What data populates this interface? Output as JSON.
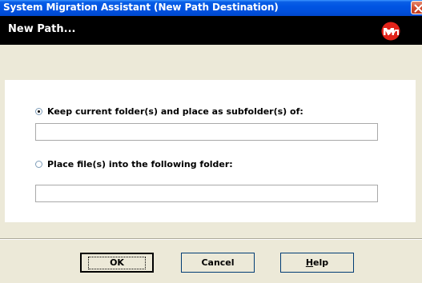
{
  "window": {
    "title": "System Migration Assistant (New Path Destination)"
  },
  "header": {
    "title": "New Path..."
  },
  "options": [
    {
      "label": "Keep current folder(s) and place as subfolder(s) of:",
      "checked": true,
      "value": ""
    },
    {
      "label": "Place file(s) into the following folder:",
      "checked": false,
      "value": ""
    }
  ],
  "buttons": {
    "ok": "OK",
    "cancel": "Cancel",
    "help_mnemonic": "H",
    "help_rest": "elp"
  },
  "colors": {
    "titlebar": "#0054e3",
    "header_bg": "#000000",
    "logo_red": "#e2231a",
    "dialog_bg": "#ece9d8"
  },
  "icons": {
    "close": "close-icon",
    "logo": "company-logo-icon"
  }
}
